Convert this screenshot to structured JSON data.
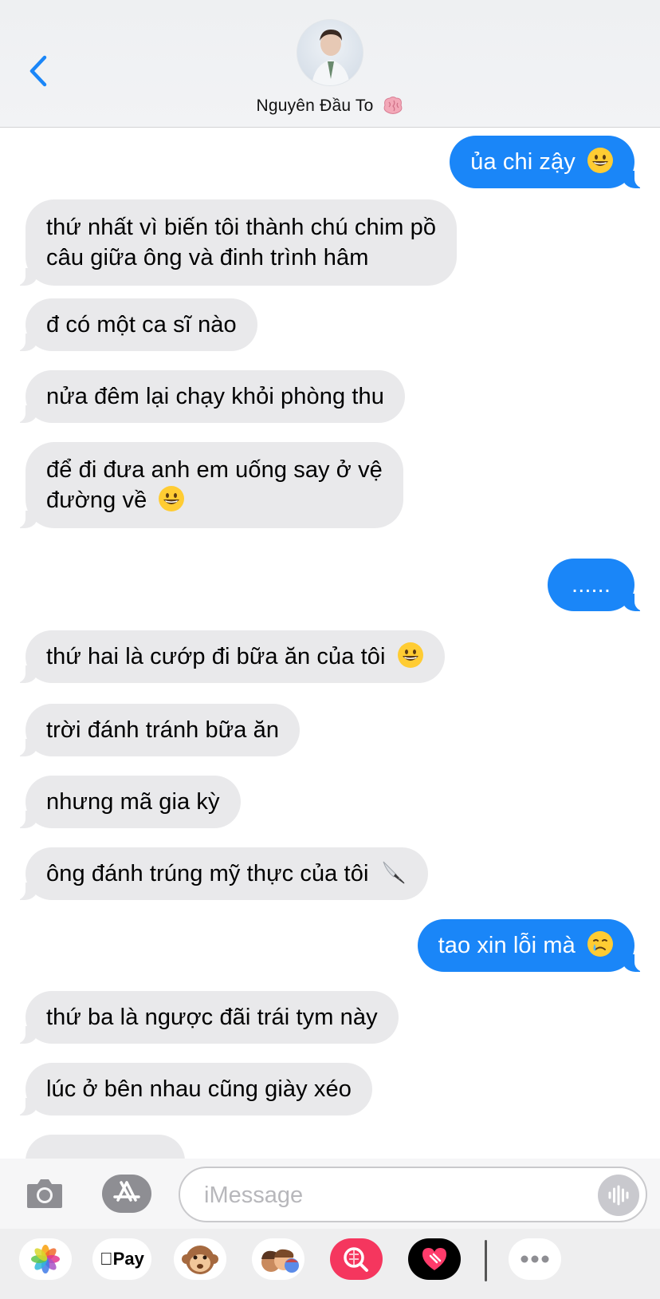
{
  "header": {
    "contact_name": "Nguyên Đầu To",
    "contact_emoji_icon": "brain-icon",
    "back_icon": "chevron-left-icon",
    "accent_color": "#1a86f8"
  },
  "messages": [
    {
      "dir": "out",
      "text": "ủa chi zậy",
      "emoji": "grinning-face-icon"
    },
    {
      "dir": "in",
      "text": "thứ nhất vì biến tôi thành chú chim pồ",
      "text2": "câu giữa ông và đinh trình hâm"
    },
    {
      "dir": "in",
      "text": "đ có một ca sĩ nào"
    },
    {
      "dir": "in",
      "text": "nửa đêm lại chạy khỏi phòng thu"
    },
    {
      "dir": "in",
      "text": "để đi đưa anh em uống say ở vệ",
      "text2": "đường về",
      "emoji": "grinning-face-icon"
    },
    {
      "dir": "out",
      "text": "......"
    },
    {
      "dir": "in",
      "text": "thứ hai là cướp đi bữa ăn của tôi",
      "emoji": "grinning-face-icon"
    },
    {
      "dir": "in",
      "text": "trời đánh tránh bữa ăn"
    },
    {
      "dir": "in",
      "text": "nhưng mã gia kỳ"
    },
    {
      "dir": "in",
      "text": "ông đánh trúng mỹ thực của tôi",
      "emoji": "knife-icon"
    },
    {
      "dir": "out",
      "text": "tao xin lỗi mà",
      "emoji": "crying-face-icon"
    },
    {
      "dir": "in",
      "text": "thứ ba là ngược đãi trái tym này"
    },
    {
      "dir": "in",
      "text": "lúc ở bên nhau cũng giày xéo"
    }
  ],
  "compose": {
    "placeholder": "iMessage",
    "camera_icon": "camera-icon",
    "appstore_icon": "app-store-icon",
    "audio_icon": "audio-waveform-icon"
  },
  "app_strip": {
    "items": [
      "photos-icon",
      "apple-pay-icon",
      "animoji-icon",
      "memoji-icon",
      "image-search-icon",
      "digital-touch-icon",
      "more-icon"
    ],
    "apple_pay_label": "Pay"
  }
}
